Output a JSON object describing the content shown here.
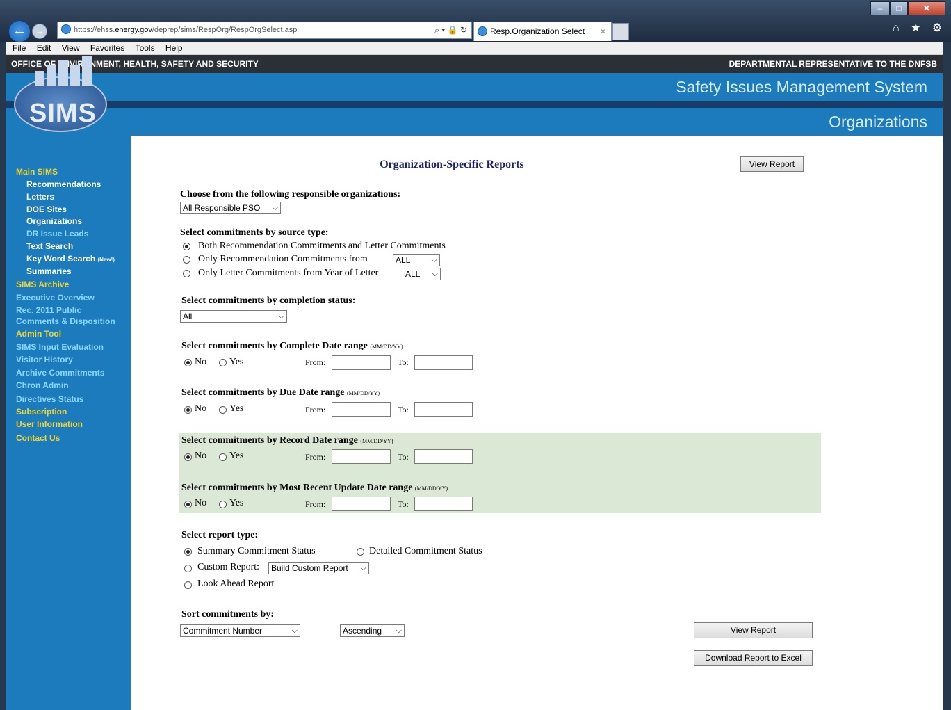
{
  "browser": {
    "url_prefix": "https://ehss.",
    "url_domain": "energy.gov",
    "url_path": "/deprep/sims/RespOrg/RespOrgSelect.asp",
    "addr_icons": "⌕ ▾ 🔒 ↻",
    "tab_title": "Resp.Organization Select",
    "tab_close": "×",
    "menu": [
      "File",
      "Edit",
      "View",
      "Favorites",
      "Tools",
      "Help"
    ],
    "tool_icons": "⌂ ★ ⚙",
    "window_buttons": {
      "min": "–",
      "max": "□",
      "close": "✕"
    }
  },
  "header": {
    "left": "OFFICE OF ENVIRONMENT, HEALTH, SAFETY AND SECURITY",
    "right": "DEPARTMENTAL REPRESENTATIVE TO THE DNFSB",
    "app_title": "Safety Issues Management System",
    "section_title": "Organizations",
    "logo_text": "SIMS"
  },
  "sidebar": {
    "main_sims": "Main SIMS",
    "sub": [
      "Recommendations",
      "Letters",
      "DOE Sites",
      "Organizations",
      "DR Issue Leads",
      "Text Search",
      "Key Word Search"
    ],
    "new_tag": "(New!)",
    "summaries": "Summaries",
    "links": [
      "SIMS Archive",
      "Executive Overview",
      "Rec. 2011 Public",
      "Comments & Disposition",
      "Admin Tool",
      "SIMS Input Evaluation",
      "Visitor History",
      "Archive Commitments",
      "Chron Admin",
      "Directives Status",
      "Subscription",
      "User Information",
      "Contact Us"
    ]
  },
  "form": {
    "heading": "Organization-Specific Reports",
    "view_report": "View Report",
    "orgs_label": "Choose from the following responsible organizations:",
    "orgs_value": "All Responsible PSO",
    "source_label": "Select commitments by source type:",
    "source_opt1": "Both Recommendation Commitments and Letter Commitments",
    "source_opt2": "Only Recommendation Commitments from",
    "source_opt2_value": "ALL",
    "source_opt3": "Only Letter Commitments from Year of Letter",
    "source_opt3_value": "ALL",
    "status_label": "Select commitments by completion status:",
    "status_value": "All",
    "complete_label": "Select commitments by Complete Date range",
    "due_label": "Select commitments by Due Date range",
    "record_label": "Select commitments by Record Date range",
    "update_label": "Select commitments by Most Recent Update Date range",
    "date_note": "(MM/DD/YY)",
    "no": "No",
    "yes": "Yes",
    "from": "From:",
    "to": "To:",
    "report_label": "Select report type:",
    "report_summary": "Summary Commitment Status",
    "report_detailed": "Detailed Commitment Status",
    "report_custom": "Custom Report:",
    "report_custom_value": "Build Custom Report",
    "report_lookahead": "Look Ahead Report",
    "sort_label": "Sort commitments by:",
    "sort_value": "Commitment Number",
    "order_value": "Ascending",
    "view_report_bottom": "View Report",
    "download": "Download Report to Excel",
    "dropdown_arrow": "⌵"
  }
}
